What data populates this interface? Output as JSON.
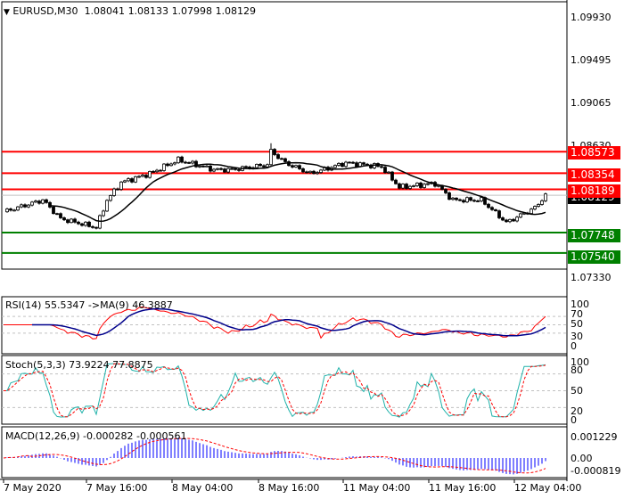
{
  "header": {
    "symbol": "EURUSD,M30",
    "open": "1.08041",
    "high": "1.08133",
    "low": "1.07998",
    "close": "1.08129"
  },
  "price_scale": [
    "1.09930",
    "1.09495",
    "1.09065",
    "1.08630",
    "1.07330"
  ],
  "current_price": "1.08129",
  "levels": [
    {
      "value": "1.08573",
      "color": "#ff0000"
    },
    {
      "value": "1.08354",
      "color": "#ff0000"
    },
    {
      "value": "1.08189",
      "color": "#ff0000"
    },
    {
      "value": "1.07748",
      "color": "#008000"
    },
    {
      "value": "1.07540",
      "color": "#008000"
    }
  ],
  "rsi": {
    "label": "RSI(14) 55.5347  ->MA(9) 46.3887",
    "scale": [
      "100",
      "70",
      "50",
      "30",
      "0"
    ]
  },
  "stoch": {
    "label": "Stoch(5,3,3) 73.9224 77.8875",
    "scale": [
      "100",
      "80",
      "50",
      "20",
      "0"
    ]
  },
  "macd": {
    "label": "MACD(12,26,9) -0.000282 -0.000561",
    "scale": [
      "0.001229",
      "0.00",
      "-0.000819"
    ]
  },
  "time_axis": [
    "7 May 2020",
    "7 May 16:00",
    "8 May 04:00",
    "8 May 16:00",
    "11 May 04:00",
    "11 May 16:00",
    "12 May 04:00"
  ],
  "chart_data": {
    "type": "candlestick",
    "title": "EURUSD,M30",
    "waypoints_bar_close": [
      [
        0,
        1.0796
      ],
      [
        11,
        1.0808
      ],
      [
        16,
        1.0789
      ],
      [
        26,
        1.078
      ],
      [
        29,
        1.0808
      ],
      [
        33,
        1.0826
      ],
      [
        41,
        1.0835
      ],
      [
        49,
        1.0849
      ],
      [
        59,
        1.0839
      ],
      [
        64,
        1.0839
      ],
      [
        74,
        1.0844
      ],
      [
        75,
        1.0858
      ],
      [
        79,
        1.0846
      ],
      [
        86,
        1.0835
      ],
      [
        96,
        1.0846
      ],
      [
        106,
        1.0842
      ],
      [
        111,
        1.0821
      ],
      [
        121,
        1.0825
      ],
      [
        126,
        1.0808
      ],
      [
        134,
        1.0808
      ],
      [
        141,
        1.0785
      ],
      [
        149,
        1.08
      ],
      [
        152,
        1.0813
      ]
    ],
    "ylim": [
      1.0725,
      1.0998
    ]
  }
}
